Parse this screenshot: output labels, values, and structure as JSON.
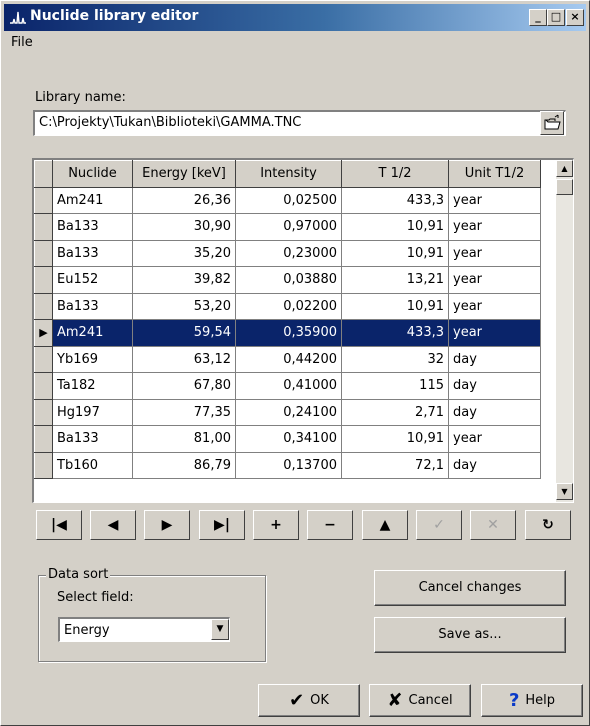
{
  "window": {
    "title": "Nuclide library editor",
    "minimize_label": "_",
    "maximize_label": "□",
    "close_label": "×"
  },
  "menu": {
    "file_label": "File"
  },
  "library": {
    "label": "Library name:",
    "path": "C:\\Projekty\\Tukan\\Biblioteki\\GAMMA.TNC"
  },
  "grid": {
    "columns": [
      "Nuclide",
      "Energy [keV]",
      "Intensity",
      "T 1/2",
      "Unit T1/2"
    ],
    "selected_row": 5,
    "selected_marker": "▶",
    "rows": [
      [
        "Am241",
        "26,36",
        "0,02500",
        "433,3",
        "year"
      ],
      [
        "Ba133",
        "30,90",
        "0,97000",
        "10,91",
        "year"
      ],
      [
        "Ba133",
        "35,20",
        "0,23000",
        "10,91",
        "year"
      ],
      [
        "Eu152",
        "39,82",
        "0,03880",
        "13,21",
        "year"
      ],
      [
        "Ba133",
        "53,20",
        "0,02200",
        "10,91",
        "year"
      ],
      [
        "Am241",
        "59,54",
        "0,35900",
        "433,3",
        "year"
      ],
      [
        "Yb169",
        "63,12",
        "0,44200",
        "32",
        "day"
      ],
      [
        "Ta182",
        "67,80",
        "0,41000",
        "115",
        "day"
      ],
      [
        "Hg197",
        "77,35",
        "0,24100",
        "2,71",
        "day"
      ],
      [
        "Ba133",
        "81,00",
        "0,34100",
        "10,91",
        "year"
      ],
      [
        "Tb160",
        "86,79",
        "0,13700",
        "72,1",
        "day"
      ]
    ],
    "scroll_up": "▲",
    "scroll_down": "▼"
  },
  "navigator": {
    "first": "|◀",
    "prior": "◀",
    "next": "▶",
    "last": "▶|",
    "insert": "+",
    "delete": "−",
    "edit": "▲",
    "post": "✓",
    "cancel": "✕",
    "refresh": "↻"
  },
  "sort": {
    "group_title": "Data sort",
    "field_label": "Select field:",
    "selected_value": "Energy",
    "dropdown_arrow": "▼"
  },
  "buttons": {
    "cancel_changes": "Cancel changes",
    "save_as": "Save as...",
    "ok": "OK",
    "ok_icon": "✔",
    "cancel": "Cancel",
    "cancel_icon": "✘",
    "help": "Help",
    "help_icon": "?"
  },
  "colors": {
    "selection": "#0a246a",
    "titlebar_start": "#0a246a",
    "titlebar_end": "#a6caf0",
    "face": "#d4d0c8"
  }
}
